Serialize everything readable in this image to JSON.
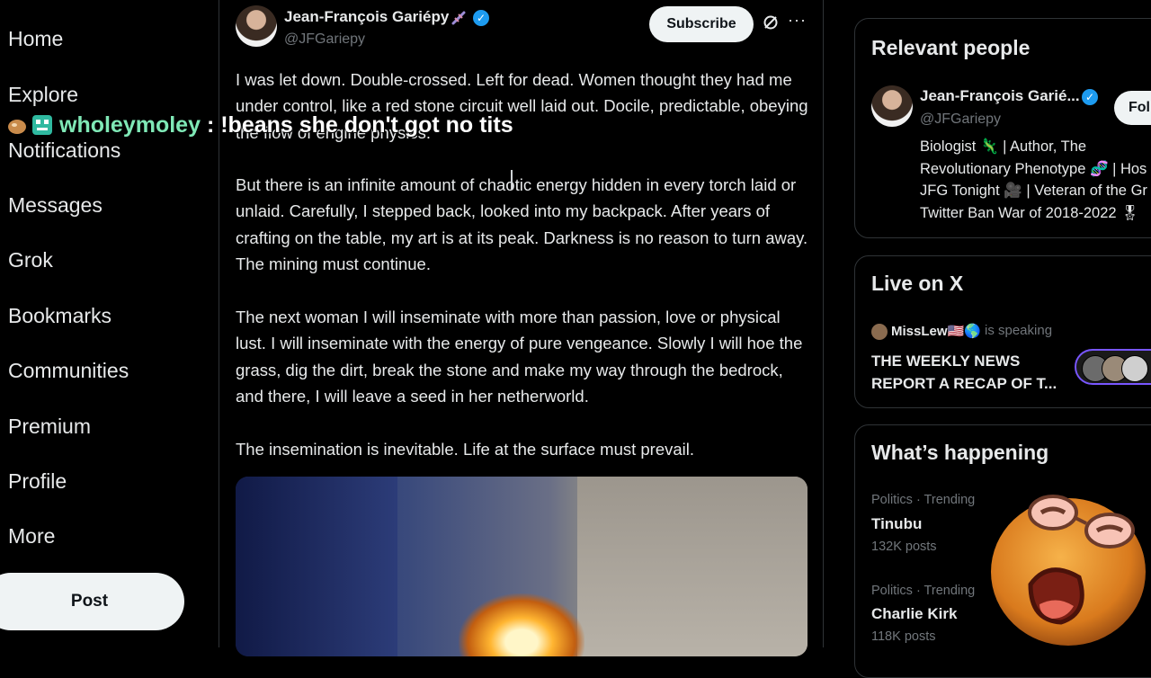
{
  "nav": {
    "items": [
      "Home",
      "Explore",
      "Notifications",
      "Messages",
      "Grok",
      "Bookmarks",
      "Communities",
      "Premium",
      "Profile",
      "More"
    ],
    "post_label": "Post"
  },
  "chat": {
    "username": "wholeymoley",
    "separator": " : ",
    "message": "!beans she don't got no tits"
  },
  "post": {
    "author_name": "Jean-François Gariépy",
    "author_handle": "@JFGariepy",
    "subscribe_label": "Subscribe",
    "more_label": "···",
    "paragraphs": [
      "I was let down. Double-crossed. Left for dead. Women thought they had me under control, like a red stone circuit well laid out. Docile, predictable, obeying the flow of engine physics.",
      "But there is an infinite amount of chaotic energy hidden in every torch laid or unlaid. Carefully, I stepped back, looked into my backpack. After years of crafting on the table, my art is at its peak. Darkness is no reason to turn away. The mining must continue.",
      "The next woman I will inseminate with more than passion, love or physical lust. I will inseminate with the energy of pure vengeance. Slowly I will hoe the grass, dig the dirt, break the stone and make my way through the bedrock, and there, I will leave a seed in her netherworld.",
      "The insemination is inevitable. Life at the surface must prevail."
    ]
  },
  "relevant_people": {
    "title": "Relevant people",
    "name": "Jean-François Garié...",
    "handle": "@JFGariepy",
    "follow_label": "Foll",
    "bio_lines": [
      "Biologist 🦎 | Author, The",
      "Revolutionary Phenotype 🧬 | Hos",
      "JFG Tonight 🎥 | Veteran of the Gr",
      "Twitter Ban War of 2018-2022 🎖"
    ]
  },
  "live": {
    "title": "Live on X",
    "host": "MissLew🇺🇸🌎",
    "status": "is speaking",
    "space_title": "THE WEEKLY NEWS REPORT A RECAP OF T..."
  },
  "trending": {
    "title": "What’s happening",
    "items": [
      {
        "category": "Politics · Trending",
        "name": "Tinubu",
        "count": "132K posts"
      },
      {
        "category": "Politics · Trending",
        "name": "Charlie Kirk",
        "count": "118K posts"
      }
    ]
  },
  "colors": {
    "background": "#000000",
    "text": "#e7e9ea",
    "muted": "#71767b",
    "verified": "#1d9bf0",
    "chat_user": "#7fe8b6",
    "live_ring": "#7856ff"
  }
}
